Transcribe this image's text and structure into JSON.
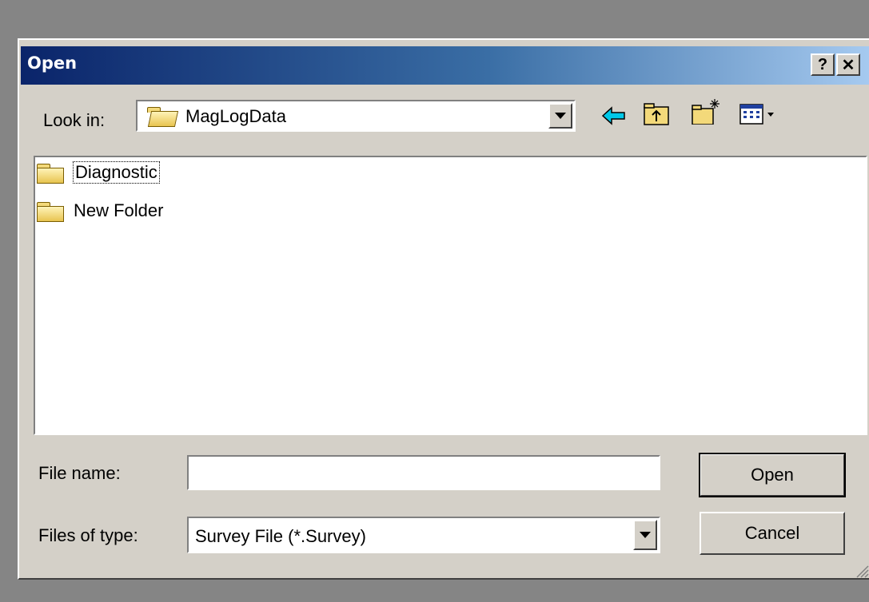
{
  "window": {
    "title": "Open",
    "help_label": "?",
    "close_label": "✕"
  },
  "toolbar": {
    "look_in_label": "Look in:",
    "look_in_value": "MagLogData",
    "look_in_icon": "folder-open-icon",
    "tools": [
      "back-arrow-icon",
      "up-folder-icon",
      "new-folder-icon",
      "view-menu-icon"
    ]
  },
  "file_list": {
    "items": [
      {
        "name": "Diagnostic",
        "icon": "folder-icon",
        "focused": true
      },
      {
        "name": "New Folder",
        "icon": "folder-icon",
        "focused": false
      }
    ]
  },
  "form": {
    "file_name_label": "File name:",
    "file_name_value": "",
    "files_of_type_label": "Files of type:",
    "files_of_type_value": "Survey File (*.Survey)"
  },
  "buttons": {
    "open_label": "Open",
    "cancel_label": "Cancel"
  },
  "colors": {
    "title_gradient_start": "#0a246a",
    "title_gradient_end": "#a6caf0",
    "dialog_face": "#d4d0c8",
    "desktop": "#858585",
    "back_arrow": "#00b4d8"
  }
}
